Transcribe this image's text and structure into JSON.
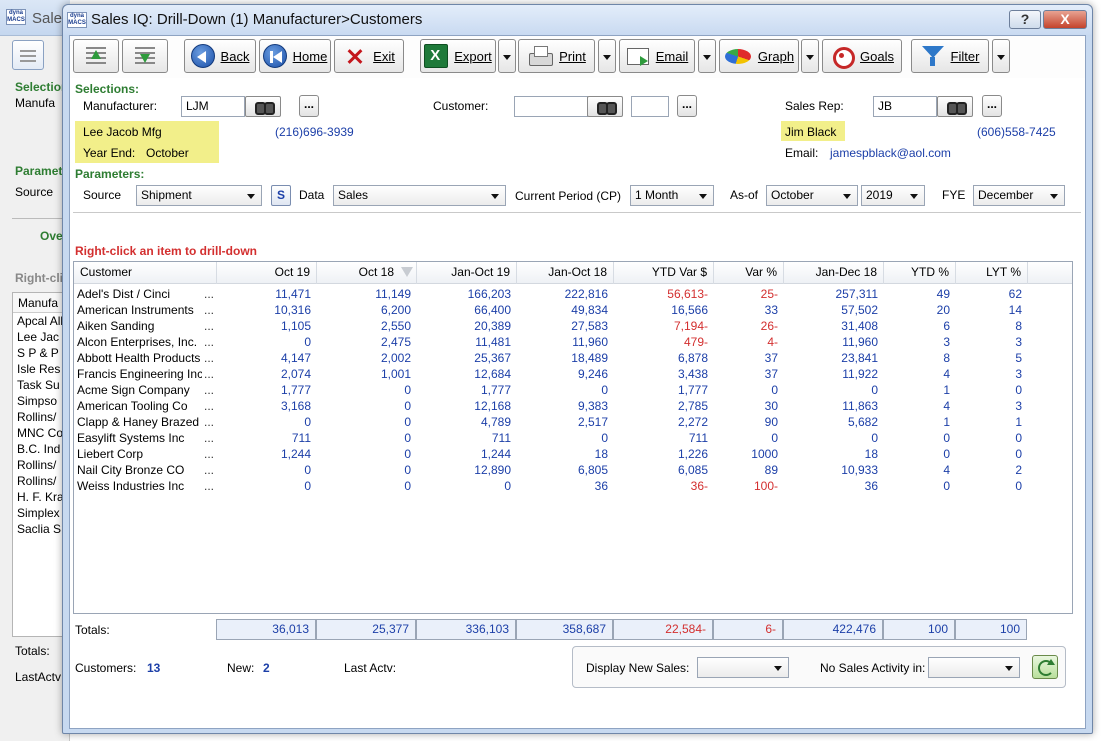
{
  "bg_window": {
    "title": "Sales",
    "section_selections": "Selections",
    "manufacturer_label": "Manufa",
    "section_parameters": "Paramet",
    "source_label": "Source",
    "tab_label": "Ove",
    "hint": "Right-cli",
    "list_header": "Manufa",
    "list_items": [
      "Apcal All",
      "Lee Jac",
      "S P & P",
      "Isle Res",
      "Task Su",
      "Simpso",
      "Rollins/",
      "MNC Co",
      "B.C. Ind",
      "Rollins/",
      "Rollins/",
      "H. F. Kra",
      "Simplex",
      "Saclia S"
    ],
    "totals_label": "Totals:",
    "last_actv_label": "LastActv"
  },
  "window": {
    "title": "Sales IQ: Drill-Down (1) Manufacturer>Customers",
    "logo_text": "dyna MACS",
    "help": "?",
    "close": "X"
  },
  "toolbar": {
    "back": "Back",
    "home": "Home",
    "exit": "Exit",
    "export": "Export",
    "print": "Print",
    "email": "Email",
    "graph": "Graph",
    "goals": "Goals",
    "filter": "Filter"
  },
  "selections": {
    "heading": "Selections:",
    "manufacturer_label": "Manufacturer:",
    "manufacturer_value": "LJM",
    "customer_label": "Customer:",
    "customer_value": "",
    "customer_value2": "",
    "sales_rep_label": "Sales Rep:",
    "sales_rep_value": "JB",
    "dots": "...",
    "mfg_name": "Lee Jacob Mfg",
    "mfg_phone": "(216)696-3939",
    "year_end_label": "Year End:",
    "year_end_value": "October",
    "rep_name": "Jim Black",
    "rep_phone": "(606)558-7425",
    "email_label": "Email:",
    "email_value": "jamespblack@aol.com"
  },
  "parameters": {
    "heading": "Parameters:",
    "source_label": "Source",
    "source_value": "Shipment",
    "s_button": "S",
    "data_label": "Data",
    "data_value": "Sales",
    "current_period_label": "Current Period (CP)",
    "current_period_value": "1 Month",
    "as_of_label": "As-of",
    "as_of_month": "October",
    "as_of_year": "2019",
    "fye_label": "FYE",
    "fye_value": "December"
  },
  "hint": "Right-click an item to drill-down",
  "grid": {
    "columns": [
      "Customer",
      "Oct 19",
      "Oct 18",
      "Jan-Oct 19",
      "Jan-Oct 18",
      "YTD Var $",
      "Var %",
      "Jan-Dec 18",
      "YTD %",
      "LYT %"
    ],
    "rows": [
      {
        "customer": "Adel's Dist / Cinci",
        "oct19": "11,471",
        "oct18": "11,149",
        "janoct19": "166,203",
        "janoct18": "222,816",
        "ytdvar": "56,613-",
        "varpct": "25-",
        "jandec18": "257,311",
        "ytdpct": "49",
        "lytpct": "62",
        "neg": true
      },
      {
        "customer": "American Instruments",
        "oct19": "10,316",
        "oct18": "6,200",
        "janoct19": "66,400",
        "janoct18": "49,834",
        "ytdvar": "16,566",
        "varpct": "33",
        "jandec18": "57,502",
        "ytdpct": "20",
        "lytpct": "14",
        "neg": false
      },
      {
        "customer": "Aiken Sanding",
        "oct19": "1,105",
        "oct18": "2,550",
        "janoct19": "20,389",
        "janoct18": "27,583",
        "ytdvar": "7,194-",
        "varpct": "26-",
        "jandec18": "31,408",
        "ytdpct": "6",
        "lytpct": "8",
        "neg": true
      },
      {
        "customer": "Alcon Enterprises, Inc.",
        "oct19": "0",
        "oct18": "2,475",
        "janoct19": "11,481",
        "janoct18": "11,960",
        "ytdvar": "479-",
        "varpct": "4-",
        "jandec18": "11,960",
        "ytdpct": "3",
        "lytpct": "3",
        "neg": true
      },
      {
        "customer": "Abbott Health Products",
        "oct19": "4,147",
        "oct18": "2,002",
        "janoct19": "25,367",
        "janoct18": "18,489",
        "ytdvar": "6,878",
        "varpct": "37",
        "jandec18": "23,841",
        "ytdpct": "8",
        "lytpct": "5",
        "neg": false
      },
      {
        "customer": "Francis Engineering Inc.",
        "oct19": "2,074",
        "oct18": "1,001",
        "janoct19": "12,684",
        "janoct18": "9,246",
        "ytdvar": "3,438",
        "varpct": "37",
        "jandec18": "11,922",
        "ytdpct": "4",
        "lytpct": "3",
        "neg": false
      },
      {
        "customer": "Acme Sign Company",
        "oct19": "1,777",
        "oct18": "0",
        "janoct19": "1,777",
        "janoct18": "0",
        "ytdvar": "1,777",
        "varpct": "0",
        "jandec18": "0",
        "ytdpct": "1",
        "lytpct": "0",
        "neg": false
      },
      {
        "customer": "American Tooling Co",
        "oct19": "3,168",
        "oct18": "0",
        "janoct19": "12,168",
        "janoct18": "9,383",
        "ytdvar": "2,785",
        "varpct": "30",
        "jandec18": "11,863",
        "ytdpct": "4",
        "lytpct": "3",
        "neg": false
      },
      {
        "customer": "Clapp & Haney Brazed",
        "oct19": "0",
        "oct18": "0",
        "janoct19": "4,789",
        "janoct18": "2,517",
        "ytdvar": "2,272",
        "varpct": "90",
        "jandec18": "5,682",
        "ytdpct": "1",
        "lytpct": "1",
        "neg": false
      },
      {
        "customer": "Easylift Systems Inc",
        "oct19": "711",
        "oct18": "0",
        "janoct19": "711",
        "janoct18": "0",
        "ytdvar": "711",
        "varpct": "0",
        "jandec18": "0",
        "ytdpct": "0",
        "lytpct": "0",
        "neg": false
      },
      {
        "customer": "Liebert Corp",
        "oct19": "1,244",
        "oct18": "0",
        "janoct19": "1,244",
        "janoct18": "18",
        "ytdvar": "1,226",
        "varpct": "1000",
        "jandec18": "18",
        "ytdpct": "0",
        "lytpct": "0",
        "neg": false
      },
      {
        "customer": "Nail City Bronze CO",
        "oct19": "0",
        "oct18": "0",
        "janoct19": "12,890",
        "janoct18": "6,805",
        "ytdvar": "6,085",
        "varpct": "89",
        "jandec18": "10,933",
        "ytdpct": "4",
        "lytpct": "2",
        "neg": false
      },
      {
        "customer": "Weiss Industries Inc",
        "oct19": "0",
        "oct18": "0",
        "janoct19": "0",
        "janoct18": "36",
        "ytdvar": "36-",
        "varpct": "100-",
        "jandec18": "36",
        "ytdpct": "0",
        "lytpct": "0",
        "neg": true
      }
    ],
    "ellipsis": "..."
  },
  "totals": {
    "label": "Totals:",
    "oct19": "36,013",
    "oct18": "25,377",
    "janoct19": "336,103",
    "janoct18": "358,687",
    "ytdvar": "22,584-",
    "varpct": "6-",
    "jandec18": "422,476",
    "ytdpct": "100",
    "lytpct": "100"
  },
  "footer": {
    "customers_label": "Customers:",
    "customers_value": "13",
    "new_label": "New:",
    "new_value": "2",
    "last_actv_label": "Last Actv:",
    "display_new_sales_label": "Display New Sales:",
    "display_new_sales_value": "",
    "no_sales_activity_label": "No Sales Activity in:",
    "no_sales_activity_value": ""
  },
  "colors": {
    "accent_blue": "#1c3fa8",
    "negative_red": "#d32f2f",
    "section_green": "#2e7d32",
    "highlight_yellow": "#f2ef8a"
  }
}
